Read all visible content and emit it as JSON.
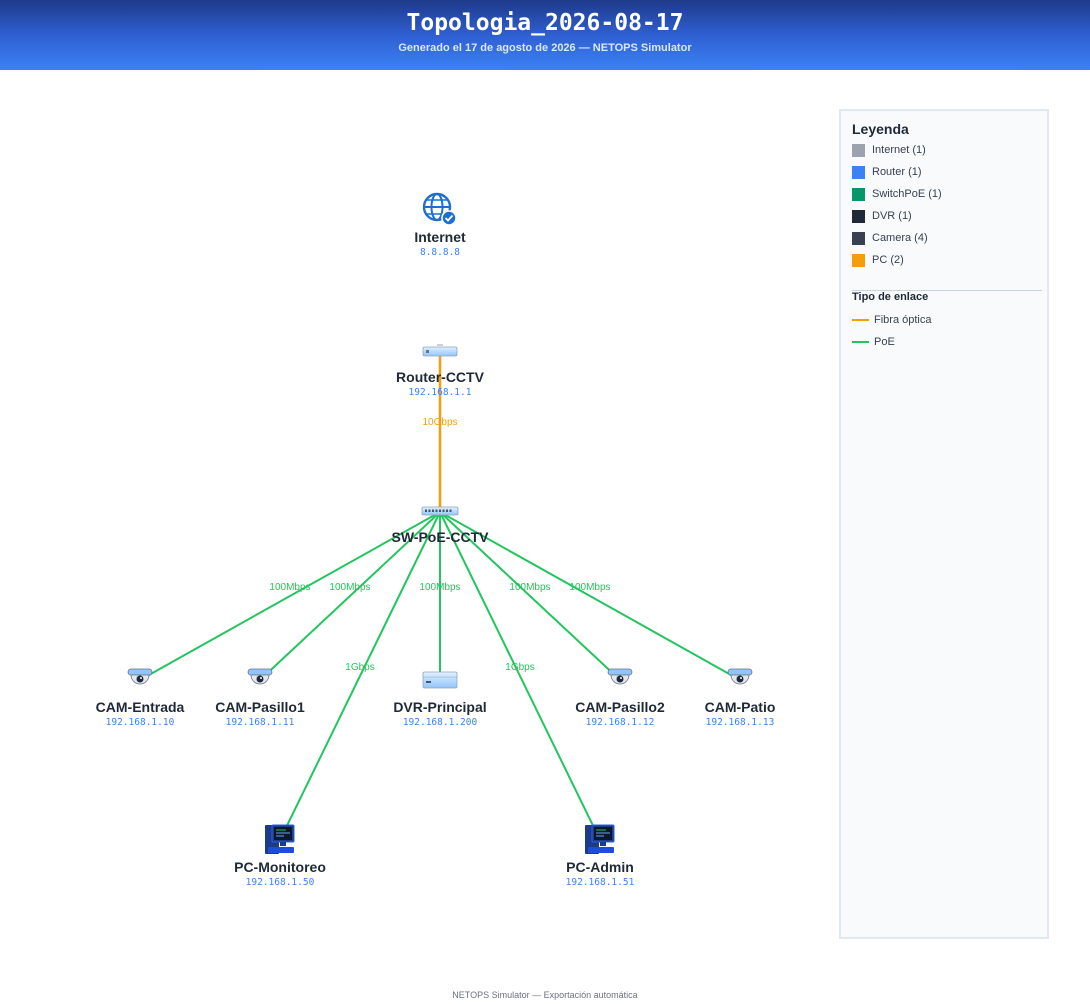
{
  "header": {
    "title": "Topologia_2026-08-17",
    "subtitle": "Generado el 17 de agosto de 2026 — NETOPS Simulator"
  },
  "colors": {
    "fibra": "#f59e0b",
    "poe": "#22c55e",
    "internet": "#9ca3af",
    "router": "#3b82f6",
    "switchpoe": "#059669",
    "dvr": "#1f2937",
    "camera": "#374151",
    "pc": "#f59e0b"
  },
  "nodes": {
    "internet": {
      "name": "Internet",
      "ip": "8.8.8.8",
      "icon": "globe-check-icon"
    },
    "router": {
      "name": "Router-CCTV",
      "ip": "192.168.1.1",
      "icon": "router-icon"
    },
    "switch": {
      "name": "SW-PoE-CCTV",
      "ip": "",
      "icon": "switch-icon"
    },
    "cam_entrada": {
      "name": "CAM-Entrada",
      "ip": "192.168.1.10",
      "icon": "dome-camera-icon"
    },
    "cam_pasillo1": {
      "name": "CAM-Pasillo1",
      "ip": "192.168.1.11",
      "icon": "dome-camera-icon"
    },
    "dvr": {
      "name": "DVR-Principal",
      "ip": "192.168.1.200",
      "icon": "dvr-icon"
    },
    "cam_pasillo2": {
      "name": "CAM-Pasillo2",
      "ip": "192.168.1.12",
      "icon": "dome-camera-icon"
    },
    "cam_patio": {
      "name": "CAM-Patio",
      "ip": "192.168.1.13",
      "icon": "dome-camera-icon"
    },
    "pc_monitoreo": {
      "name": "PC-Monitoreo",
      "ip": "192.168.1.50",
      "icon": "desktop-pc-icon"
    },
    "pc_admin": {
      "name": "PC-Admin",
      "ip": "192.168.1.51",
      "icon": "desktop-pc-icon"
    }
  },
  "links": [
    {
      "from": "router",
      "to": "switch",
      "type": "fibra",
      "label": "10Gbps"
    },
    {
      "from": "switch",
      "to": "cam_entrada",
      "type": "poe",
      "label": "100Mbps"
    },
    {
      "from": "switch",
      "to": "cam_pasillo1",
      "type": "poe",
      "label": "100Mbps"
    },
    {
      "from": "switch",
      "to": "dvr",
      "type": "poe",
      "label": "100Mbps"
    },
    {
      "from": "switch",
      "to": "cam_pasillo2",
      "type": "poe",
      "label": "100Mbps"
    },
    {
      "from": "switch",
      "to": "cam_patio",
      "type": "poe",
      "label": "100Mbps"
    },
    {
      "from": "switch",
      "to": "pc_monitoreo",
      "type": "poe",
      "label": "1Gbps"
    },
    {
      "from": "switch",
      "to": "pc_admin",
      "type": "poe",
      "label": "1Gbps"
    }
  ],
  "legend": {
    "title": "Leyenda",
    "items": [
      {
        "label": "Internet (1)",
        "color_key": "internet"
      },
      {
        "label": "Router (1)",
        "color_key": "router"
      },
      {
        "label": "SwitchPoE (1)",
        "color_key": "switchpoe"
      },
      {
        "label": "DVR (1)",
        "color_key": "dvr"
      },
      {
        "label": "Camera (4)",
        "color_key": "camera"
      },
      {
        "label": "PC (2)",
        "color_key": "pc"
      }
    ],
    "link_title": "Tipo de enlace",
    "link_types": [
      {
        "label": "Fibra óptica",
        "color_key": "fibra"
      },
      {
        "label": "PoE",
        "color_key": "poe"
      }
    ]
  },
  "footer": {
    "text": "NETOPS Simulator — Exportación automática"
  }
}
